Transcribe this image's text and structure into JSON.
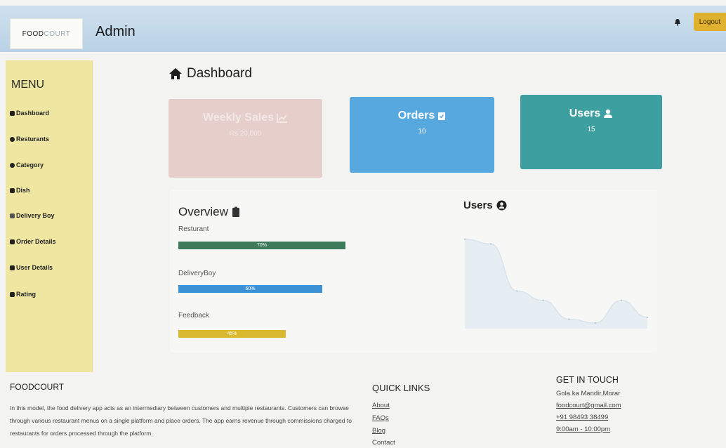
{
  "header": {
    "logo_main": "FOOD",
    "logo_accent": "COURT",
    "title": "Admin",
    "logout_label": "Logout"
  },
  "sidebar": {
    "menu_title": "MENU",
    "items": [
      {
        "label": "Dashboard",
        "icon": "dashboard-icon"
      },
      {
        "label": "Resturants",
        "icon": "restaurant-icon"
      },
      {
        "label": "Category",
        "icon": "category-icon"
      },
      {
        "label": "Dish",
        "icon": "dish-icon"
      },
      {
        "label": "Delivery Boy",
        "icon": "bicycle-icon"
      },
      {
        "label": "Order Details",
        "icon": "order-icon"
      },
      {
        "label": "User Details",
        "icon": "user-icon"
      },
      {
        "label": "Rating",
        "icon": "rating-icon"
      }
    ]
  },
  "main": {
    "title": "Dashboard",
    "cards": {
      "sales": {
        "title": "Weekly Sales",
        "value": "Rs.20,000",
        "color": "#e6cfcb"
      },
      "orders": {
        "title": "Orders",
        "value": "10",
        "color": "#58a8e0"
      },
      "users": {
        "title": "Users",
        "value": "15",
        "color": "#3e9fa0"
      }
    },
    "overview": {
      "title": "Overview",
      "bars": [
        {
          "label": "Resturant",
          "percent": 70,
          "text": "70%",
          "color": "#3d7a5a"
        },
        {
          "label": "DeliveryBoy",
          "percent": 60,
          "text": "60%",
          "color": "#3b93d6"
        },
        {
          "label": "Feedback",
          "percent": 45,
          "text": "45%",
          "color": "#d8b930"
        }
      ]
    },
    "users_chart": {
      "title": "Users"
    }
  },
  "chart_data": {
    "type": "area",
    "title": "Users",
    "x": [
      1,
      2,
      3,
      4,
      5,
      6,
      7,
      8
    ],
    "values": [
      95,
      90,
      40,
      30,
      10,
      6,
      30,
      12
    ],
    "ylim": [
      0,
      100
    ],
    "grid": false
  },
  "footer": {
    "title": "FOODCOURT",
    "description": "In this model, the food delivery app acts as an intermediary between customers and multiple restaurants. Customers can browse through various restaurant menus on a single platform and place orders. The app earns revenue through commissions charged to restaurants for orders processed through the platform.",
    "quick_links_title": "QUICK LINKS",
    "quick_links": [
      "About",
      "FAQs",
      "Blog",
      "Contact"
    ],
    "contact_title": "GET IN TOUCH",
    "contact": [
      "Gola ka Mandir,Morar",
      "foodcourt@gmail.com",
      "+91 98493 38499",
      "9:00am - 10:00pm"
    ]
  }
}
